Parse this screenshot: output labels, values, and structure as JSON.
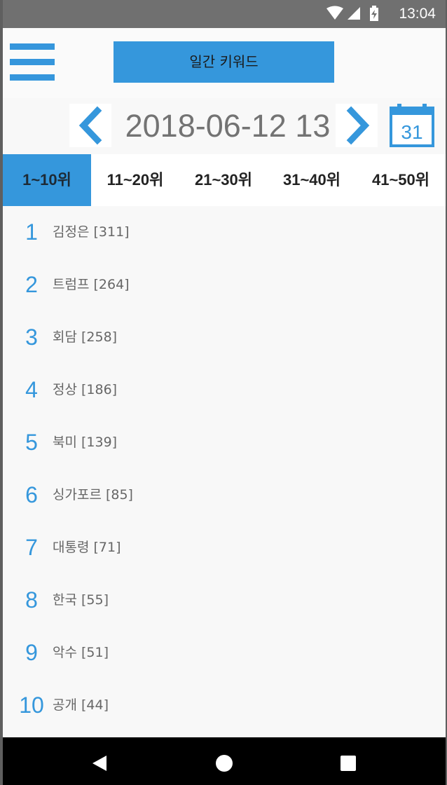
{
  "status_bar": {
    "time": "13:04",
    "icons": [
      "wifi-icon",
      "signal-icon",
      "battery-charging-icon"
    ]
  },
  "header": {
    "title": "일간 키워드",
    "menu_icon": "hamburger-menu-icon"
  },
  "date_nav": {
    "date": "2018-06-12 13",
    "prev_icon": "chevron-left-icon",
    "next_icon": "chevron-right-icon",
    "calendar_icon": "calendar-icon",
    "calendar_day": "31"
  },
  "tabs": [
    {
      "label": "1~10위",
      "active": true
    },
    {
      "label": "11~20위",
      "active": false
    },
    {
      "label": "21~30위",
      "active": false
    },
    {
      "label": "31~40위",
      "active": false
    },
    {
      "label": "41~50위",
      "active": false
    }
  ],
  "keywords": [
    {
      "rank": "1",
      "text": "김정은 [311]"
    },
    {
      "rank": "2",
      "text": "트럼프 [264]"
    },
    {
      "rank": "3",
      "text": "회담 [258]"
    },
    {
      "rank": "4",
      "text": "정상 [186]"
    },
    {
      "rank": "5",
      "text": "북미 [139]"
    },
    {
      "rank": "6",
      "text": "싱가포르 [85]"
    },
    {
      "rank": "7",
      "text": "대통령 [71]"
    },
    {
      "rank": "8",
      "text": "한국 [55]"
    },
    {
      "rank": "9",
      "text": "악수 [51]"
    },
    {
      "rank": "10",
      "text": "공개 [44]"
    }
  ],
  "nav_bar": [
    "back-icon",
    "home-icon",
    "recents-icon"
  ],
  "colors": {
    "accent": "#3597dc",
    "status_bar": "#707070",
    "nav_bar": "#000000"
  }
}
